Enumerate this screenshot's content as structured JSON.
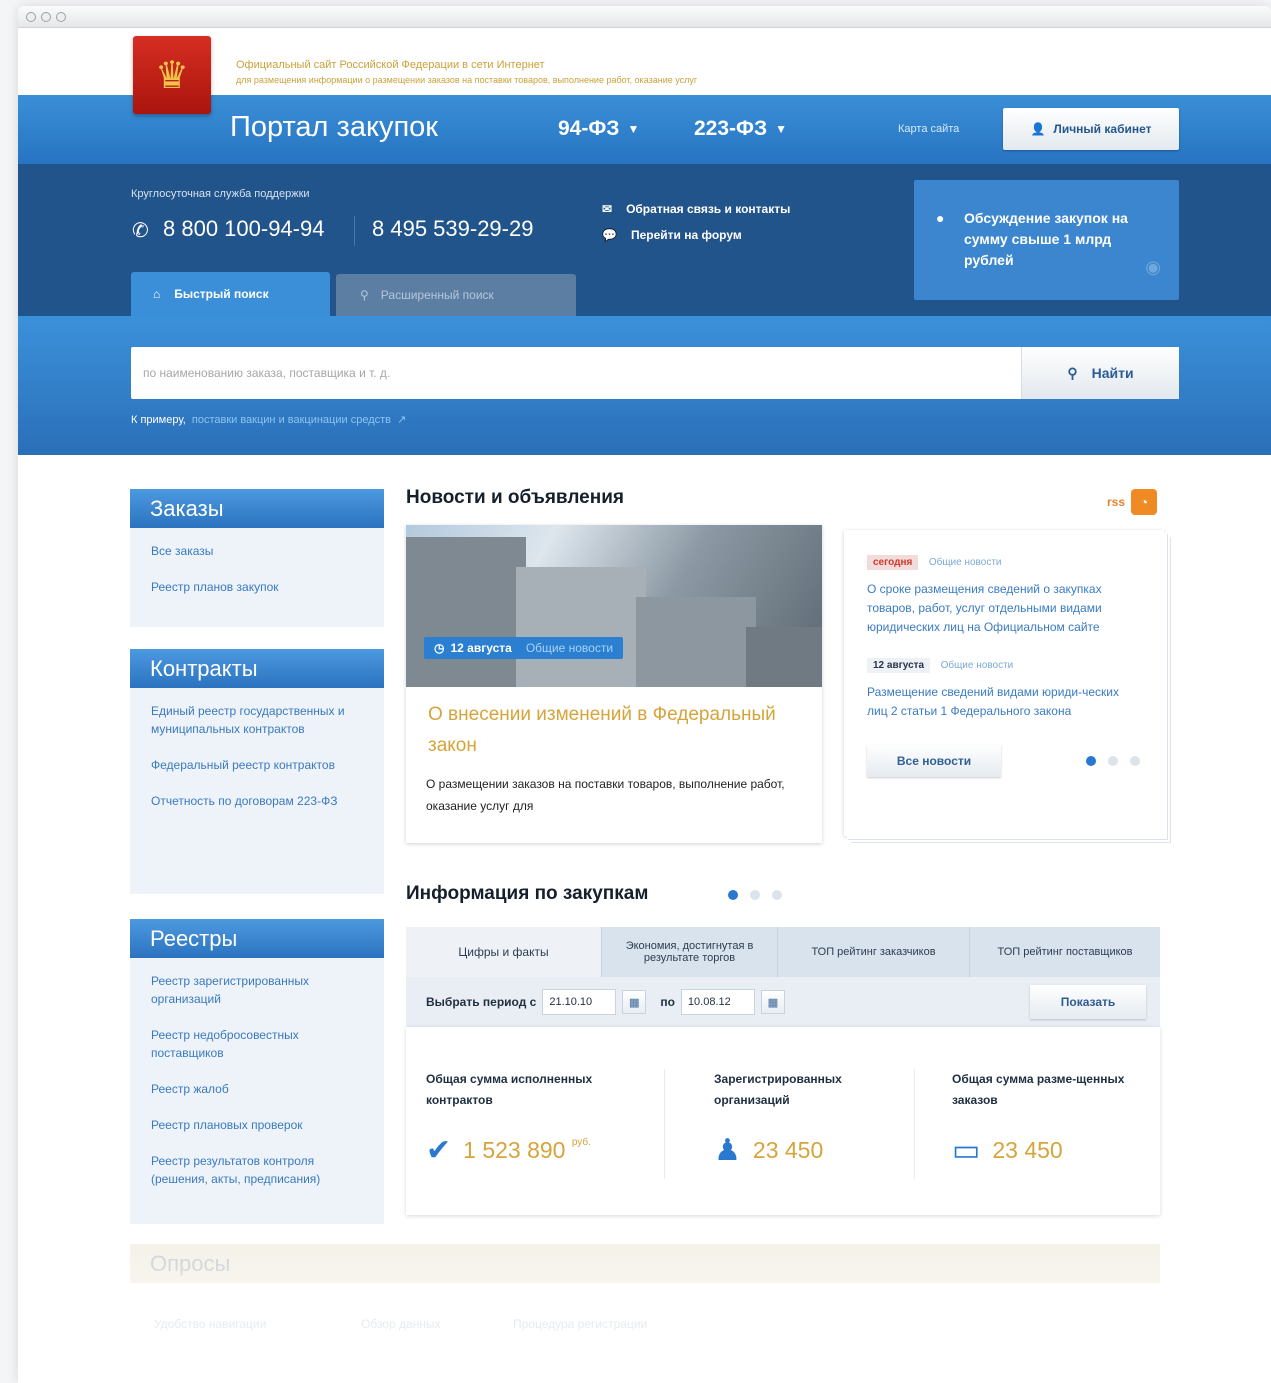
{
  "header": {
    "site_line1": "Официальный сайт Российской Федерации в сети Интернет",
    "site_line2": "для размещения информации о размещении заказов на поставки товаров, выполнение работ, оказание услуг",
    "portal_title": "Портал закупок",
    "nav": [
      {
        "label": "94-ФЗ"
      },
      {
        "label": "223-ФЗ"
      }
    ],
    "sitemap": "Карта сайта",
    "cabinet": "Личный кабинет"
  },
  "support": {
    "label": "Круглосуточная служба поддержки",
    "phone1": "8 800 100-94-94",
    "phone2": "8 495 539-29-29",
    "feedback": "Обратная связь и контакты",
    "forum": "Перейти на форум",
    "discussion": "Обсуждение закупок на сумму свыше 1 млрд рублей"
  },
  "search": {
    "tab_quick": "Быстрый поиск",
    "tab_extended": "Расширенный поиск",
    "placeholder": "по наименованию заказа, поставщика и т. д.",
    "button": "Найти",
    "example_label": "К примеру,",
    "example_link": "поставки вакцин и вакцинации средств"
  },
  "sidebar": {
    "orders": {
      "title": "Заказы",
      "items": [
        "Все заказы",
        "Реестр планов закупок"
      ]
    },
    "contracts": {
      "title": "Контракты",
      "items": [
        "Единый реестр государственных и муниципальных контрактов",
        "Федеральный реестр контрактов",
        "Отчетность по договорам 223-ФЗ"
      ]
    },
    "registries": {
      "title": "Реестры",
      "items": [
        "Реестр зарегистрированных организаций",
        "Реестр недобросовестных поставщиков",
        "Реестр жалоб",
        "Реестр плановых проверок",
        "Реестр результатов контроля (решения, акты, предписания)"
      ]
    }
  },
  "news": {
    "title": "Новости и объявления",
    "rss": "rss",
    "main": {
      "date": "12 августа",
      "category": "Общие новости",
      "headline": "О внесении изменений в Федеральный закон",
      "lead": "О размещении заказов на поставки товаров, выполнение работ, оказание услуг для"
    },
    "side": [
      {
        "tag": "сегодня",
        "category": "Общие новости",
        "text": "О сроке размещения сведений о закупках товаров, работ, услуг отдельными видами юридических лиц на Официальном сайте"
      },
      {
        "tag": "12 августа",
        "category": "Общие новости",
        "text": "Размещение сведений видами юриди-ческих лиц 2 статьи 1 Федерального закона"
      }
    ],
    "all_news": "Все новости"
  },
  "procurement": {
    "title": "Информация по закупкам",
    "tabs": [
      "Цифры и факты",
      "Экономия, достигнутая в результате торгов",
      "ТОП рейтинг заказчиков",
      "ТОП рейтинг поставщиков"
    ],
    "period_label": "Выбрать период  с",
    "date_from": "21.10.10",
    "to_label": "по",
    "date_to": "10.08.12",
    "show_button": "Показать",
    "stats": [
      {
        "label": "Общая сумма исполненных контрактов",
        "value": "1 523 890",
        "unit": "руб.",
        "icon": "checkmark-icon"
      },
      {
        "label": "Зарегистрированных организаций",
        "value": "23 450",
        "unit": "",
        "icon": "user-icon"
      },
      {
        "label": "Общая сумма разме-щенных заказов",
        "value": "23 450",
        "unit": "",
        "icon": "monitor-icon"
      }
    ]
  },
  "polls": {
    "title": "Опросы",
    "links": [
      "Удобство навигации",
      "Обзор данных",
      "Процедура регистрации"
    ]
  },
  "colors": {
    "brand_blue": "#2a78cf",
    "dark_blue": "#22548c",
    "accent_gold": "#d6a43a",
    "rss_orange": "#f08a24"
  }
}
